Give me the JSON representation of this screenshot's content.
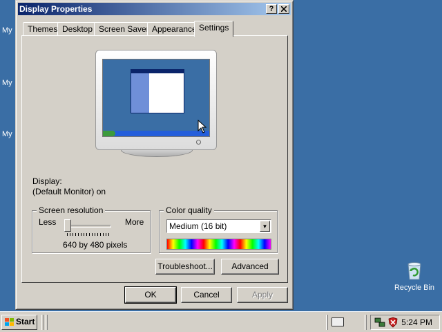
{
  "desktop": {
    "labels": [
      "My",
      "My",
      "My"
    ],
    "recycle_bin": "Recycle Bin"
  },
  "window": {
    "title": "Display Properties",
    "help_btn": "?",
    "close_btn": "X",
    "tabs": [
      "Themes",
      "Desktop",
      "Screen Saver",
      "Appearance",
      "Settings"
    ],
    "active_tab": "Settings",
    "display_label": "Display:",
    "display_value": "(Default Monitor) on",
    "screen_resolution": {
      "title": "Screen resolution",
      "less": "Less",
      "more": "More",
      "value_text": "640 by 480 pixels",
      "slider_position": 0
    },
    "color_quality": {
      "title": "Color quality",
      "selected": "Medium (16 bit)"
    },
    "troubleshoot_btn": "Troubleshoot...",
    "advanced_btn": "Advanced",
    "ok_btn": "OK",
    "cancel_btn": "Cancel",
    "apply_btn": "Apply"
  },
  "taskbar": {
    "start": "Start",
    "clock": "5:24 PM"
  },
  "colors": {
    "desktop": "#3a6ea5",
    "title_start": "#0a246a",
    "title_end": "#a6caf0",
    "face": "#d4d0c8"
  }
}
